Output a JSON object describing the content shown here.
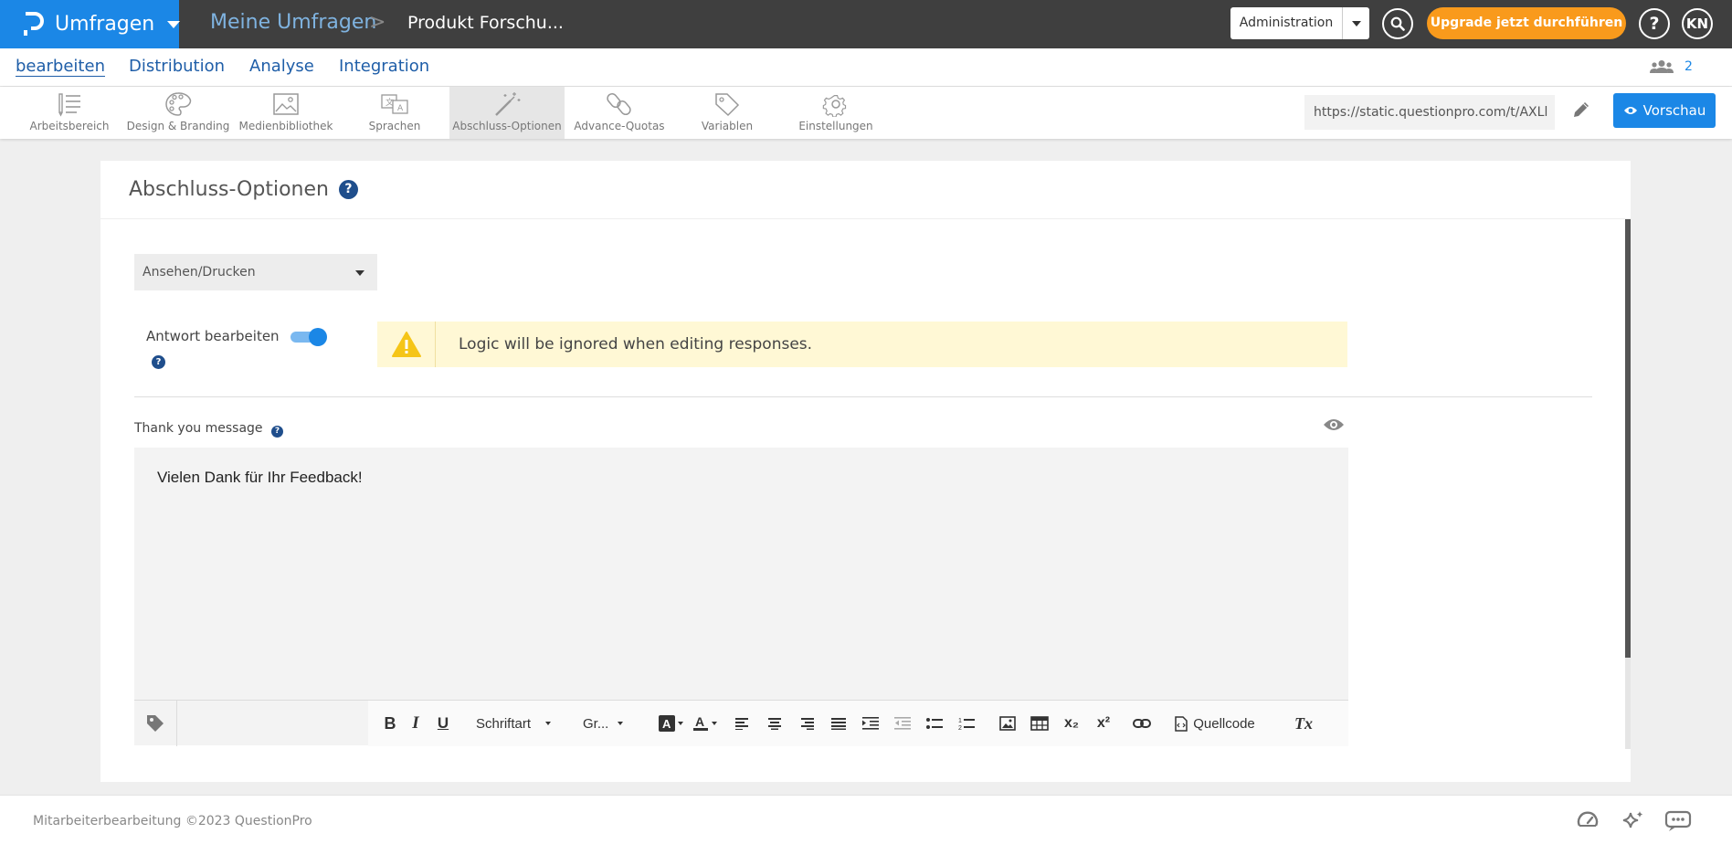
{
  "topbar": {
    "app_name": "Umfragen",
    "breadcrumb_root": "Meine Umfragen",
    "breadcrumb_separator": ">",
    "survey_name": "Produkt Forschu...",
    "admin_label": "Administration",
    "upgrade_label": "Upgrade jetzt durchführen",
    "help_label": "?",
    "user_initials": "KN"
  },
  "tabs": [
    {
      "label": "bearbeiten",
      "active": true
    },
    {
      "label": "Distribution",
      "active": false
    },
    {
      "label": "Analyse",
      "active": false
    },
    {
      "label": "Integration",
      "active": false
    }
  ],
  "collaborators": {
    "count": "2"
  },
  "toolbar": {
    "items": [
      {
        "label": "Arbeitsbereich",
        "icon": "workspace-icon"
      },
      {
        "label": "Design & Branding",
        "icon": "palette-icon"
      },
      {
        "label": "Medienbibliothek",
        "icon": "image-icon"
      },
      {
        "label": "Sprachen",
        "icon": "translate-icon"
      },
      {
        "label": "Abschluss-Optionen",
        "icon": "magic-wand-icon",
        "active": true
      },
      {
        "label": "Advance-Quotas",
        "icon": "link-icon"
      },
      {
        "label": "Variablen",
        "icon": "tag-icon"
      },
      {
        "label": "Einstellungen",
        "icon": "gear-icon"
      }
    ],
    "survey_url": "https://static.questionpro.com/t/AXLl",
    "preview_label": "Vorschau"
  },
  "card": {
    "title": "Abschluss-Optionen",
    "help_label": "?",
    "dropdown_value": "Ansehen/Drucken",
    "toggle_label": "Antwort bearbeiten",
    "toggle_on": true,
    "warning_text": "Logic will be ignored when editing responses.",
    "thank_you_label": "Thank you message",
    "message_text": "Vielen Dank für Ihr Feedback!"
  },
  "editor_toolbar": {
    "bold": "B",
    "italic": "I",
    "underline": "U",
    "font_label": "Schriftart",
    "size_label": "Gr...",
    "subscript": "x₂",
    "superscript": "x²",
    "source_label": "Quellcode",
    "clear_format": "Tx"
  },
  "footer": {
    "text": "Mitarbeiterbearbeitung ©2023 QuestionPro"
  }
}
